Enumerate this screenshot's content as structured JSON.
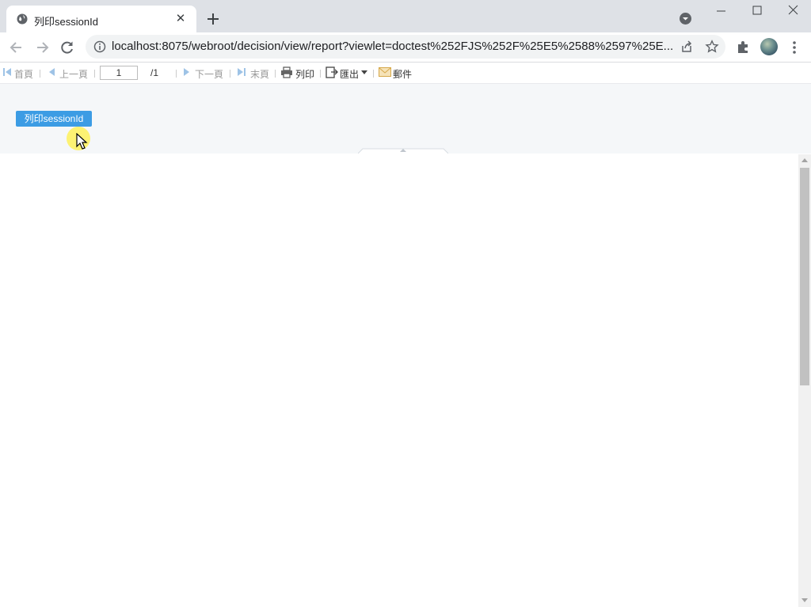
{
  "browser": {
    "tab_title": "列印sessionId",
    "tab_close": "✕",
    "url": "localhost:8075/webroot/decision/view/report?viewlet=doctest%252FJS%252F%25E5%2588%2597%25E..."
  },
  "report_toolbar": {
    "first_page": "首頁",
    "prev_page": "上一頁",
    "page_number": "1",
    "page_total": "/1",
    "next_page": "下一頁",
    "last_page": "末頁",
    "print": "列印",
    "export": "匯出",
    "email": "郵件"
  },
  "params": {
    "session_button": "列印sessionId"
  },
  "colors": {
    "accent": "#3c9ce4",
    "tab_bar": "#dee1e6",
    "param_bg": "#f5f7f9"
  }
}
